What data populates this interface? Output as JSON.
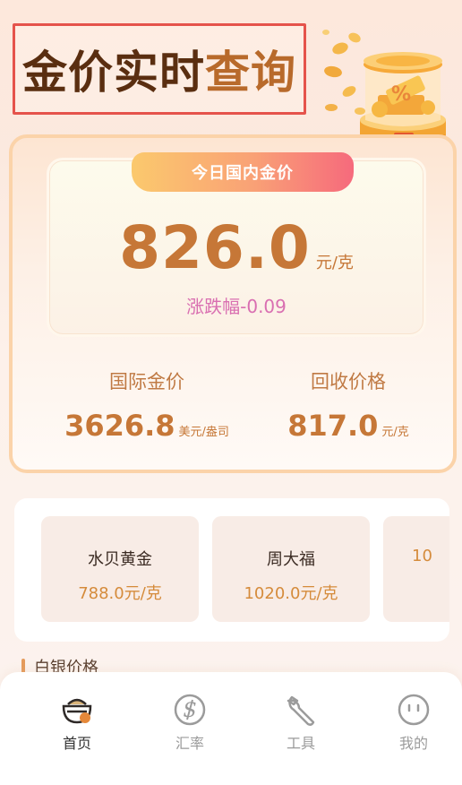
{
  "header": {
    "title_part1": "金价实时",
    "title_part2": "查询"
  },
  "today": {
    "tab_label": "今日国内金价",
    "price": "826.0",
    "unit": "元/克",
    "change": "涨跌幅-0.09"
  },
  "international": {
    "label": "国际金价",
    "value": "3626.8",
    "unit": "美元/盎司"
  },
  "recycle": {
    "label": "回收价格",
    "value": "817.0",
    "unit": "元/克"
  },
  "brands": [
    {
      "name": "水贝黄金",
      "price": "788.0元/克"
    },
    {
      "name": "周大福",
      "price": "1020.0元/克"
    },
    {
      "name": "",
      "price": "10"
    }
  ],
  "silver_section": {
    "title": "白银价格"
  },
  "nav": {
    "items": [
      {
        "label": "首页",
        "icon": "home-bowl-icon",
        "active": true
      },
      {
        "label": "汇率",
        "icon": "dollar-icon",
        "active": false
      },
      {
        "label": "工具",
        "icon": "wrench-icon",
        "active": false
      },
      {
        "label": "我的",
        "icon": "face-icon",
        "active": false
      }
    ]
  },
  "colors": {
    "accent": "#c67737",
    "change": "#d96fb1",
    "title_frame": "#e5534b"
  }
}
